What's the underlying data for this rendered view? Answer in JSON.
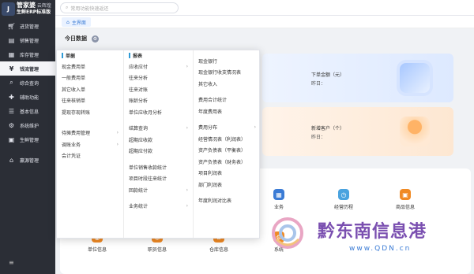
{
  "brand": {
    "name": "管家婆",
    "sub": "云辉煌",
    "edition": "生鲜ERP标准版",
    "logo": "J"
  },
  "sidebar": {
    "items": [
      {
        "label": "进货管理",
        "icon": "cart-icon"
      },
      {
        "label": "销售管理",
        "icon": "sales-icon"
      },
      {
        "label": "库存管理",
        "icon": "warehouse-icon"
      },
      {
        "label": "钱流管理",
        "icon": "money-icon",
        "active": true
      },
      {
        "label": "综合查询",
        "icon": "query-icon"
      },
      {
        "label": "辅助功能",
        "icon": "tools-icon"
      },
      {
        "label": "基本信息",
        "icon": "info-icon"
      },
      {
        "label": "系统维护",
        "icon": "system-icon"
      },
      {
        "label": "生鲜管理",
        "icon": "fresh-icon"
      }
    ],
    "extra": {
      "label": "赢源管理",
      "icon": "store-icon"
    }
  },
  "search": {
    "placeholder": "常用功能快速返还"
  },
  "tabs": {
    "home": "主界面"
  },
  "dashboard": {
    "today_title": "今日数据",
    "order_amount": {
      "label": "下单金额（元）",
      "sub": "昨日："
    },
    "new_customers": {
      "label": "新增客户（个）",
      "sub": "昨日："
    },
    "quick": [
      {
        "label": "业务",
        "color": "#3a7bd5"
      },
      {
        "label": "经营历程",
        "color": "#4aa3df"
      },
      {
        "label": "商品信息",
        "color": "#f08a24"
      }
    ],
    "bottom": [
      {
        "label": "单位信息",
        "color": "#f08a24"
      },
      {
        "label": "职员信息",
        "color": "#f08a24"
      },
      {
        "label": "仓库信息",
        "color": "#f08a24"
      },
      {
        "label": "系统",
        "color": "#f08a24"
      }
    ]
  },
  "menu": {
    "col1": {
      "header": "单据",
      "items": [
        "现金费用单",
        "一般费用单",
        "其它收入单",
        "往来核销单",
        "提现存现转账"
      ],
      "items2": [
        {
          "label": "待摊费用管理",
          "arrow": "›"
        },
        {
          "label": "调账业务",
          "arrow": "›"
        },
        {
          "label": "会计凭证",
          "arrow": ""
        }
      ]
    },
    "col2": {
      "header": "报表",
      "items": [
        {
          "label": "应收应付",
          "arrow": "›"
        },
        {
          "label": "往来分析",
          "arrow": ""
        },
        {
          "label": "往来对账",
          "arrow": ""
        },
        {
          "label": "账龄分析",
          "arrow": ""
        },
        {
          "label": "单位应收月分析",
          "arrow": ""
        },
        {
          "label": "",
          "arrow": ""
        },
        {
          "label": "结算查询",
          "arrow": "›"
        },
        {
          "label": "超期应收款",
          "arrow": ""
        },
        {
          "label": "超期应付款",
          "arrow": ""
        },
        {
          "label": "",
          "arrow": ""
        },
        {
          "label": "单位销售收款统计",
          "arrow": ""
        },
        {
          "label": "项目时段往来统计",
          "arrow": ""
        },
        {
          "label": "回款统计",
          "arrow": "›"
        },
        {
          "label": "",
          "arrow": ""
        },
        {
          "label": "业务统计",
          "arrow": "›"
        }
      ]
    },
    "col3": {
      "items": [
        {
          "label": "现金银行",
          "arrow": ""
        },
        {
          "label": "现金银行收支情况表",
          "arrow": ""
        },
        {
          "label": "其它收入",
          "arrow": ""
        },
        {
          "label": "",
          "arrow": ""
        },
        {
          "label": "费用合计统计",
          "arrow": ""
        },
        {
          "label": "年度费用表",
          "arrow": ""
        },
        {
          "label": "",
          "arrow": ""
        },
        {
          "label": "费用分布",
          "arrow": "›"
        },
        {
          "label": "经营情况表（利润表）",
          "arrow": ""
        },
        {
          "label": "资产负债表（平衡表）",
          "arrow": ""
        },
        {
          "label": "资产负债表（财务表）",
          "arrow": ""
        },
        {
          "label": "项目利润表",
          "arrow": ""
        },
        {
          "label": "部门利润表",
          "arrow": ""
        },
        {
          "label": "",
          "arrow": ""
        },
        {
          "label": "年度利润对比表",
          "arrow": ""
        }
      ]
    }
  },
  "watermark": {
    "text": "黔东南信息港",
    "url": "www.QDN.cn"
  }
}
